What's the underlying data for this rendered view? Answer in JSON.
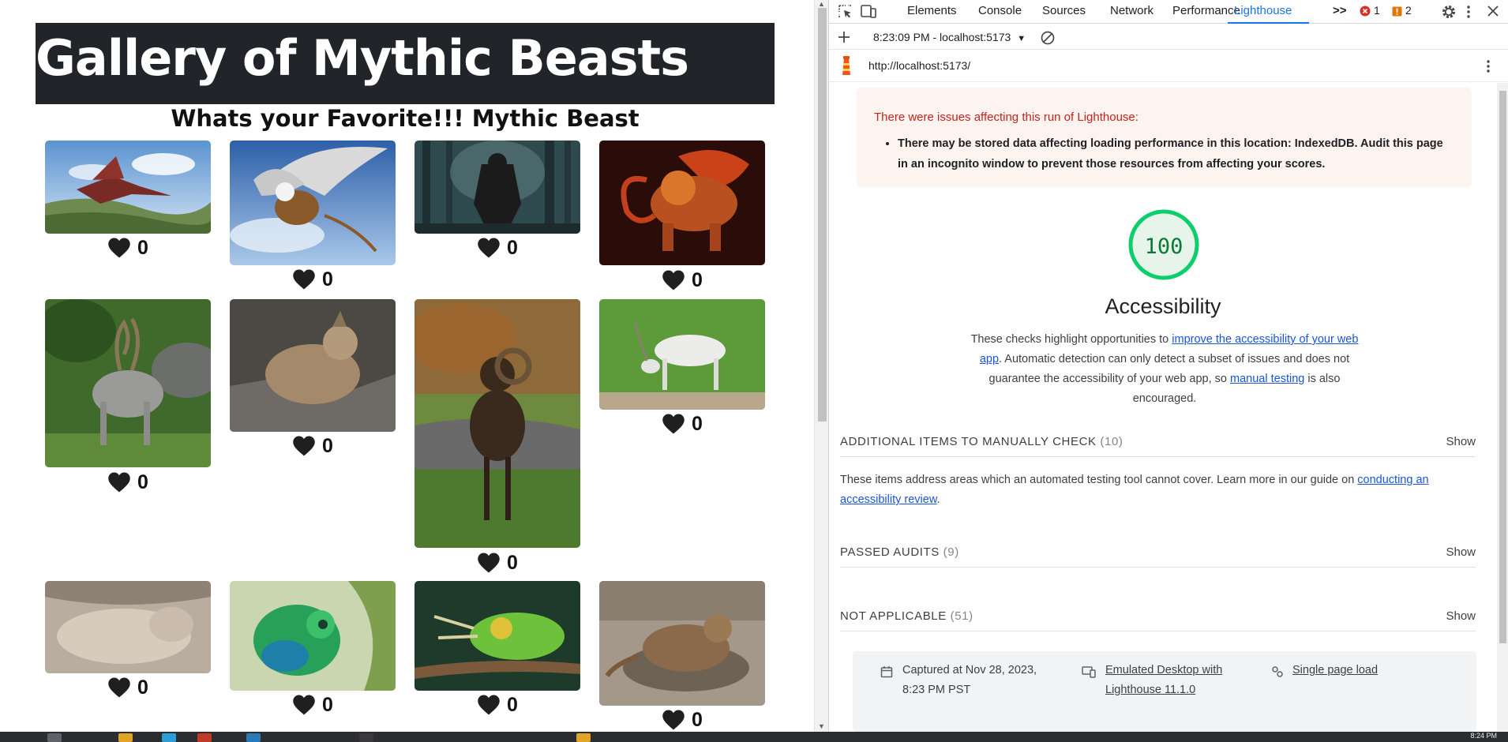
{
  "page": {
    "title": "Gallery of Mythic Beasts",
    "subtitle": "Whats your Favorite!!! Mythic Beast",
    "cards": [
      {
        "name": "red dragon on a grassy hill",
        "likes": "0"
      },
      {
        "name": "griffin in flight",
        "likes": "0"
      },
      {
        "name": "werewolf in a dark forest",
        "likes": "0"
      },
      {
        "name": "fire lion beast",
        "likes": "0"
      },
      {
        "name": "markhor goat",
        "likes": "0"
      },
      {
        "name": "young goat on rocks",
        "likes": "0"
      },
      {
        "name": "mouflon ram",
        "likes": "0"
      },
      {
        "name": "white addax antelope",
        "likes": "0"
      },
      {
        "name": "sleeping kangaroo",
        "likes": "0"
      },
      {
        "name": "green chameleon",
        "likes": "0"
      },
      {
        "name": "Jackson's chameleon",
        "likes": "0"
      },
      {
        "name": "horned lizard",
        "likes": "0"
      }
    ]
  },
  "devtools": {
    "tabs": [
      "Elements",
      "Console",
      "Sources",
      "Network",
      "Performance",
      "Lighthouse"
    ],
    "active_tab": "Lighthouse",
    "more_tabs": ">>",
    "errors_count": "1",
    "warnings_count": "2",
    "report_label": "8:23:09 PM - localhost:5173",
    "url": "http://localhost:5173/",
    "warning": {
      "title": "There were issues affecting this run of Lighthouse:",
      "items": [
        "There may be stored data affecting loading performance in this location: IndexedDB. Audit this page in an incognito window to prevent those resources from affecting your scores."
      ]
    },
    "score": "100",
    "score_color": "#0cce6b",
    "category": "Accessibility",
    "description": {
      "p1": "These checks highlight opportunities to ",
      "link1": "improve the accessibility of your web app",
      "p2": ". Automatic detection can only detect a subset of issues and does not guarantee the accessibility of your web app, so ",
      "link2": "manual testing",
      "p3": " is also encouraged."
    },
    "groups": [
      {
        "title": "ADDITIONAL ITEMS TO MANUALLY CHECK",
        "count": "(10)",
        "action": "Show"
      },
      {
        "title": "PASSED AUDITS",
        "count": "(9)",
        "action": "Show"
      },
      {
        "title": "NOT APPLICABLE",
        "count": "(51)",
        "action": "Show"
      }
    ],
    "manual": {
      "text": "These items address areas which an automated testing tool cannot cover. Learn more in our guide on ",
      "link": "conducting an accessibility review",
      "end": "."
    },
    "footer": {
      "captured": "Captured at Nov 28, 2023, 8:23 PM PST",
      "device": "Emulated Desktop with Lighthouse 11.1.0",
      "mode": "Single page load"
    }
  },
  "taskbar": {
    "clock": "8:24 PM"
  }
}
